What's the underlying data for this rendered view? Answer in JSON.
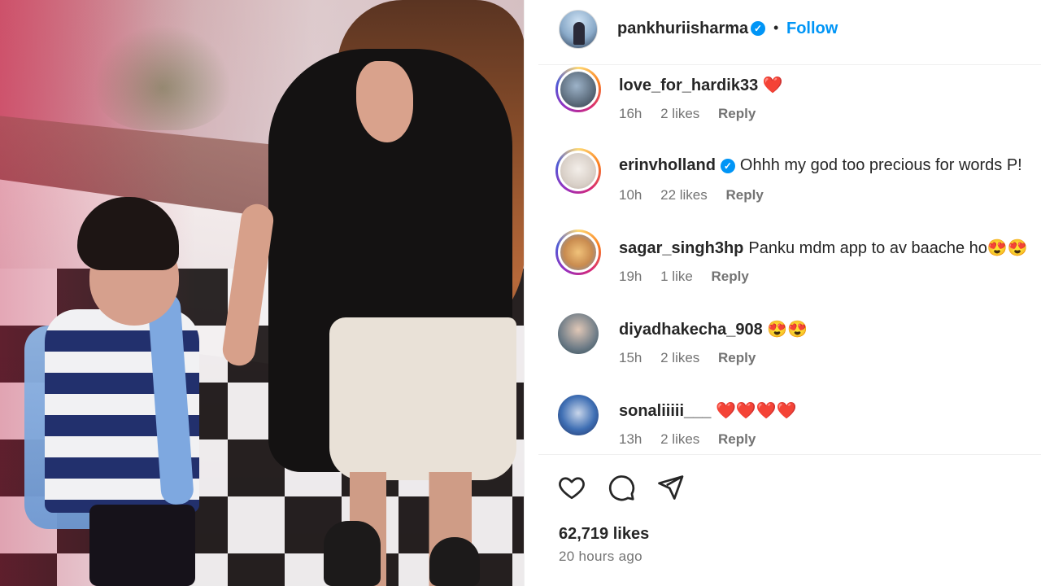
{
  "post": {
    "author": "pankhuriisharma",
    "verified": true,
    "separator": "•",
    "follow_label": "Follow"
  },
  "comments": [
    {
      "user": "love_for_hardik33",
      "verified": false,
      "text": "",
      "emoji": "❤️",
      "time": "16h",
      "likes": "2 likes",
      "reply": "Reply",
      "avatar_icon": "story-ring-avatar"
    },
    {
      "user": "erinvholland",
      "verified": true,
      "text": "Ohhh my god too precious for words P!",
      "emoji": "",
      "time": "10h",
      "likes": "22 likes",
      "reply": "Reply",
      "avatar_icon": "story-ring-avatar"
    },
    {
      "user": "sagar_singh3hp",
      "verified": false,
      "text": "Panku mdm app to av baache ho",
      "emoji": "😍😍",
      "time": "19h",
      "likes": "1 like",
      "reply": "Reply",
      "avatar_icon": "story-ring-avatar"
    },
    {
      "user": "diyadhakecha_908",
      "verified": false,
      "text": "",
      "emoji": "😍😍",
      "time": "15h",
      "likes": "2 likes",
      "reply": "Reply",
      "avatar_icon": "plain-avatar"
    },
    {
      "user": "sonaliiiii___",
      "verified": false,
      "text": "",
      "emoji": "❤️❤️❤️❤️",
      "time": "13h",
      "likes": "2 likes",
      "reply": "Reply",
      "avatar_icon": "plain-avatar"
    }
  ],
  "actions": {
    "like_icon": "heart-outline-icon",
    "comment_icon": "comment-bubble-icon",
    "share_icon": "paper-plane-icon"
  },
  "stats": {
    "likes": "62,719 likes",
    "posted": "20 hours ago"
  },
  "colors": {
    "accent": "#0095f6",
    "text": "#262626",
    "muted": "#737373",
    "heart": "#ed4956"
  }
}
